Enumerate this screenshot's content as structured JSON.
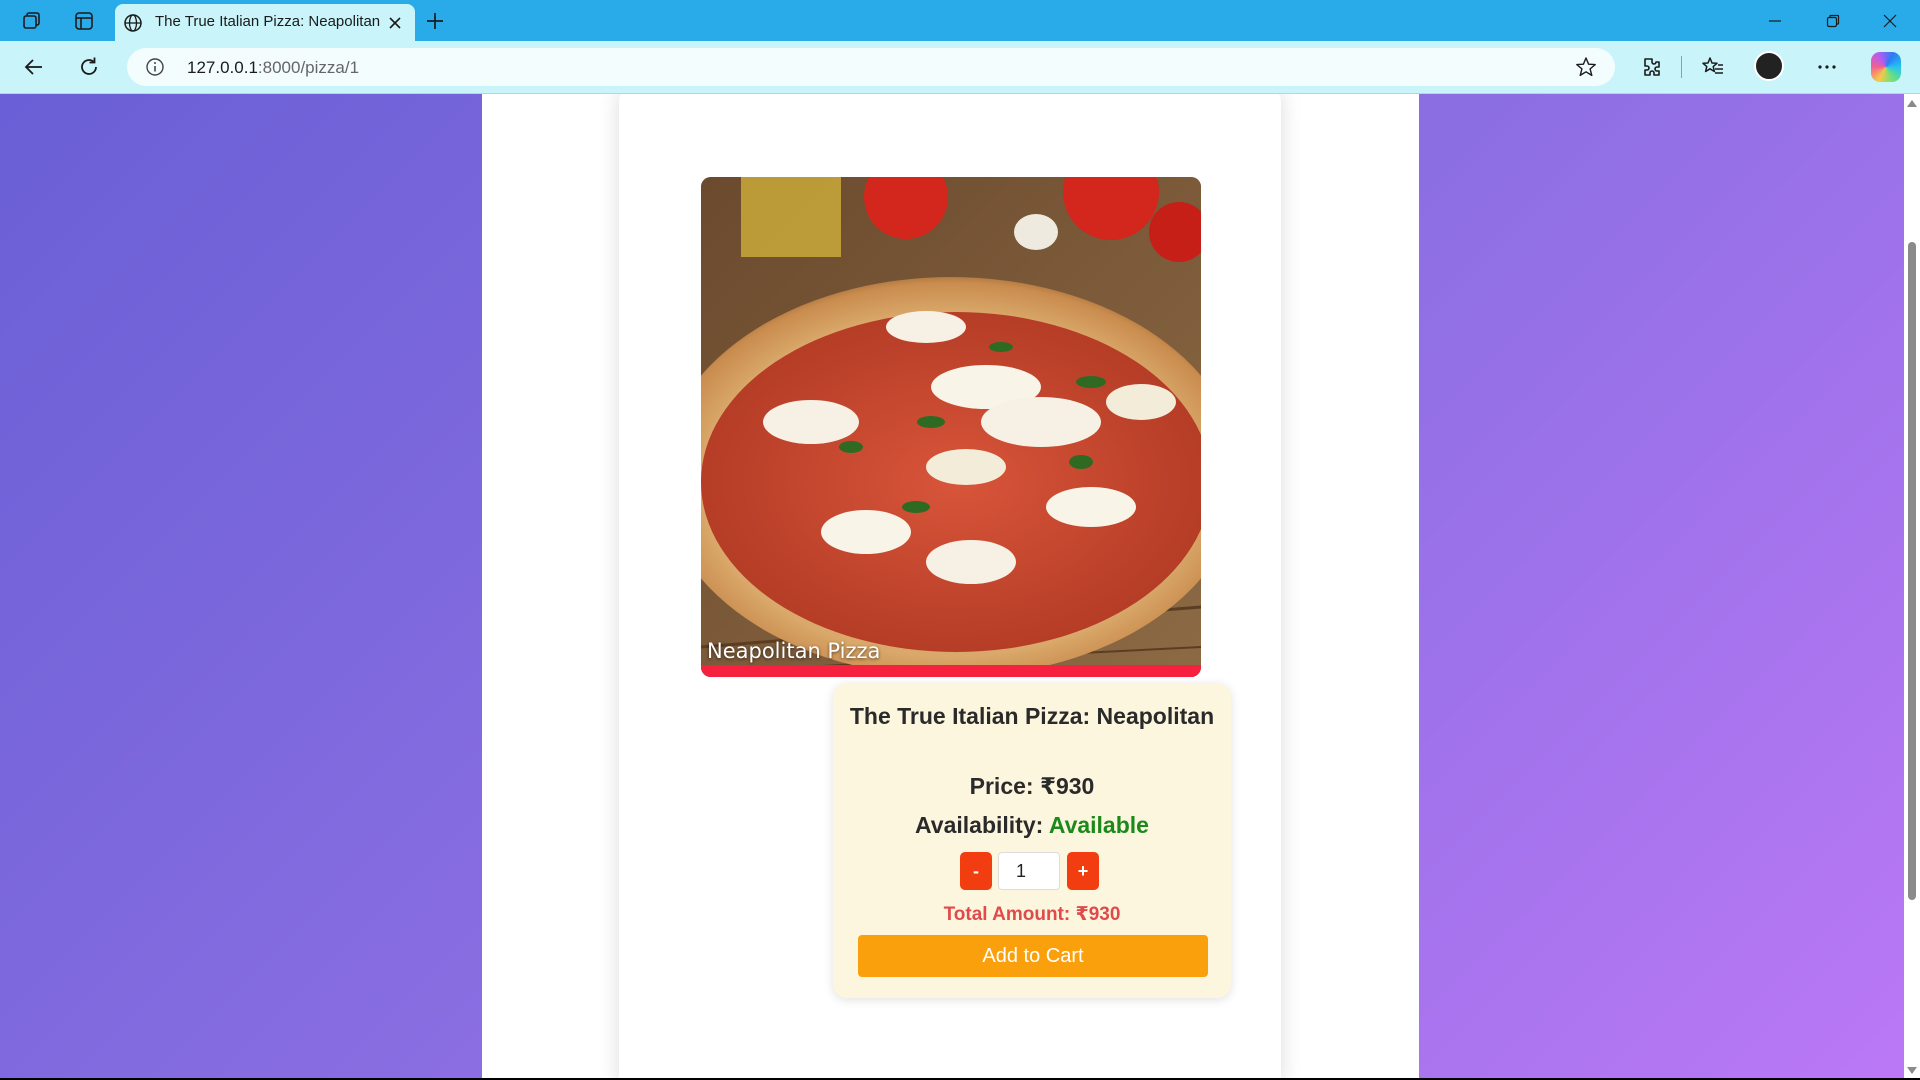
{
  "browser": {
    "tab_title": "The True Italian Pizza: Neapolitan",
    "url_host": "127.0.0.1",
    "url_path": ":8000/pizza/1",
    "icons": [
      "workspaces-icon",
      "tab-actions-icon",
      "globe-icon",
      "close-icon",
      "new-tab-icon",
      "minimize-icon",
      "restore-icon",
      "window-close-icon",
      "back-icon",
      "refresh-icon",
      "info-icon",
      "favorite-star-icon",
      "extensions-icon",
      "favorites-icon",
      "profile-avatar",
      "more-icon",
      "copilot-icon"
    ]
  },
  "product": {
    "image_caption": "Neapolitan Pizza",
    "title": "The True Italian Pizza: Neapolitan",
    "price_label": "Price: ₹930",
    "availability_label": "Availability: ",
    "availability_value": "Available",
    "decrement_label": "-",
    "quantity": "1",
    "increment_label": "+",
    "total_label": "Total Amount: ₹930",
    "add_to_cart_label": "Add to Cart"
  },
  "colors": {
    "tabstrip": "#2aabe9",
    "toolbar": "#c9f4fa",
    "background_gradient_start": "#6a5fd6",
    "background_gradient_end": "#bb78f6",
    "info_box": "#fdf6de",
    "available": "#1b8a1b",
    "qty_buttons": "#f23d10",
    "total": "#e14a4a",
    "add_to_cart": "#fba00d",
    "image_bar": "#f5213f"
  }
}
